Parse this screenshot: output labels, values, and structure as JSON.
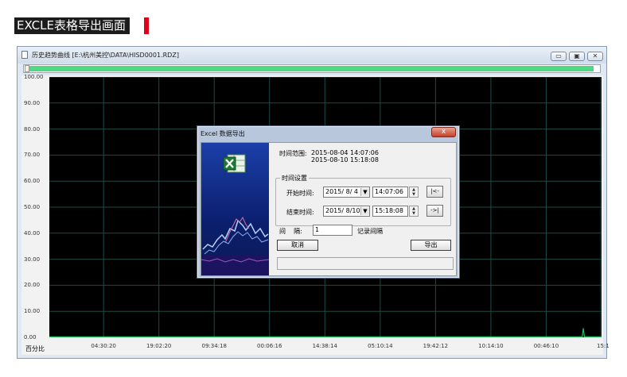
{
  "banner": {
    "title": "EXCLE表格导出画面",
    "accent": "#e1001a"
  },
  "window": {
    "title": "历史趋势曲线 [E:\\杭州美控\\DATA\\HISD0001.RDZ]",
    "buttons": {
      "minimize": "▭",
      "maximize": "▣",
      "close": "✕"
    },
    "progress_fraction": 0.99
  },
  "chart_data": {
    "type": "line",
    "y_tick_labels": [
      "100.00",
      "90.00",
      "80.00",
      "70.00",
      "60.00",
      "50.00",
      "40.00",
      "30.00",
      "20.00",
      "10.00",
      "0.00"
    ],
    "ylim": [
      0,
      100
    ],
    "unit_label": "百分比",
    "x_tick_labels": [
      "04:30:20",
      "19:02:20",
      "09:34:18",
      "00:06:16",
      "14:38:14",
      "05:10:14",
      "19:42:12",
      "10:14:10",
      "00:46:10",
      "15:1"
    ],
    "background": "#000000",
    "grid_color": "#1d4a44",
    "series": [
      {
        "color": "#1fbf5a",
        "points": [
          [
            0,
            0.2
          ],
          [
            0.965,
            0.2
          ],
          [
            0.967,
            3.5
          ],
          [
            0.969,
            0.2
          ],
          [
            1,
            0.2
          ]
        ]
      }
    ]
  },
  "dialog": {
    "title": "Excel 数据导出",
    "close": "x",
    "range_label": "时间范围:",
    "range_start": "2015-08-04 14:07:06",
    "range_end": "2015-08-10 15:18:08",
    "group_title": "时间设置",
    "start_label": "开始时间:",
    "start_date": "2015/ 8/ 4",
    "start_time": "14:07:06",
    "start_nav": "|<-",
    "end_label": "结束时间:",
    "end_date": "2015/ 8/10",
    "end_time": "15:18:08",
    "end_nav": "->|",
    "interval_label": "间    隔:",
    "interval_value": "1",
    "interval_unit": "记录间隔",
    "cancel": "取消",
    "export": "导出"
  }
}
